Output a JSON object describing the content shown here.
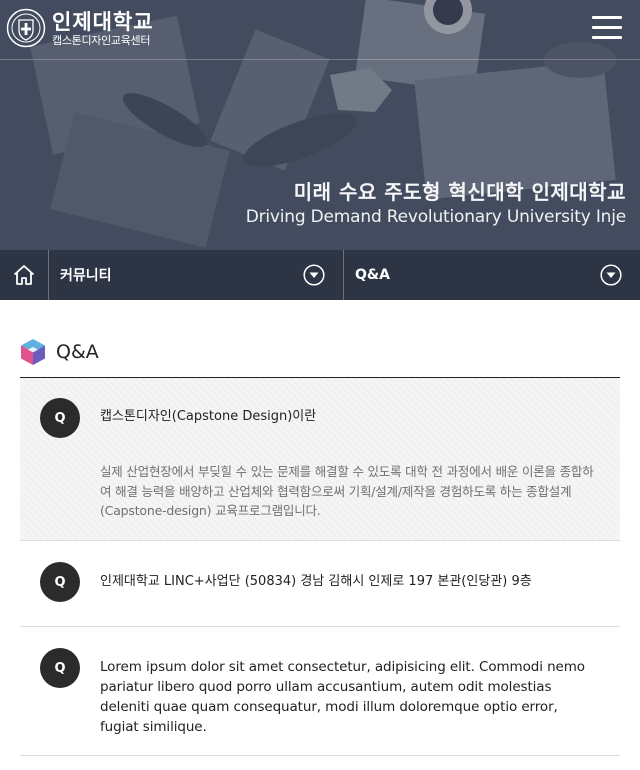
{
  "header": {
    "logo_name": "인제대학교",
    "logo_sub": "캡스톤디자인교육센터",
    "menu_icon": "hamburger-menu-icon"
  },
  "hero": {
    "slogan_ko": "미래 수요 주도형 혁신대학 인제대학교",
    "slogan_en": "Driving Demand Revolutionary University Inje"
  },
  "nav": {
    "home_icon": "home-icon",
    "select_1": "커뮤니티",
    "select_2": "Q&A",
    "dropdown_icon": "chevron-down-circle-icon"
  },
  "page": {
    "title": "Q&A",
    "title_icon": "cube-icon"
  },
  "qa_items": [
    {
      "badge": "Q",
      "question": "캡스톤디자인(Capstone Design)이란",
      "answer": "실제 산업현장에서 부딪힐 수 있는 문제를 해결할 수 있도록 대학 전 과정에서 배운 이론을 종합하여 해결 능력을 배양하고 산업체와 협력함으로써 기획/설계/제작을 경험하도록 하는 종합설계(Capstone-design) 교육프로그램입니다."
    },
    {
      "badge": "Q",
      "question": "인제대학교 LINC+사업단 (50834) 경남 김해시 인제로 197 본관(인당관) 9층"
    },
    {
      "badge": "Q",
      "question": "Lorem ipsum dolor sit amet consectetur, adipisicing elit. Commodi nemo pariatur libero quod porro ullam accusantium, autem odit molestias deleniti quae quam consequatur, modi illum doloremque optio error, fugiat similique."
    }
  ],
  "colors": {
    "badge_bg": "#2b2b2b",
    "nav_bg": "#282e3c",
    "highlight_bg": "#f5f5f5",
    "answer_text": "#707070"
  }
}
